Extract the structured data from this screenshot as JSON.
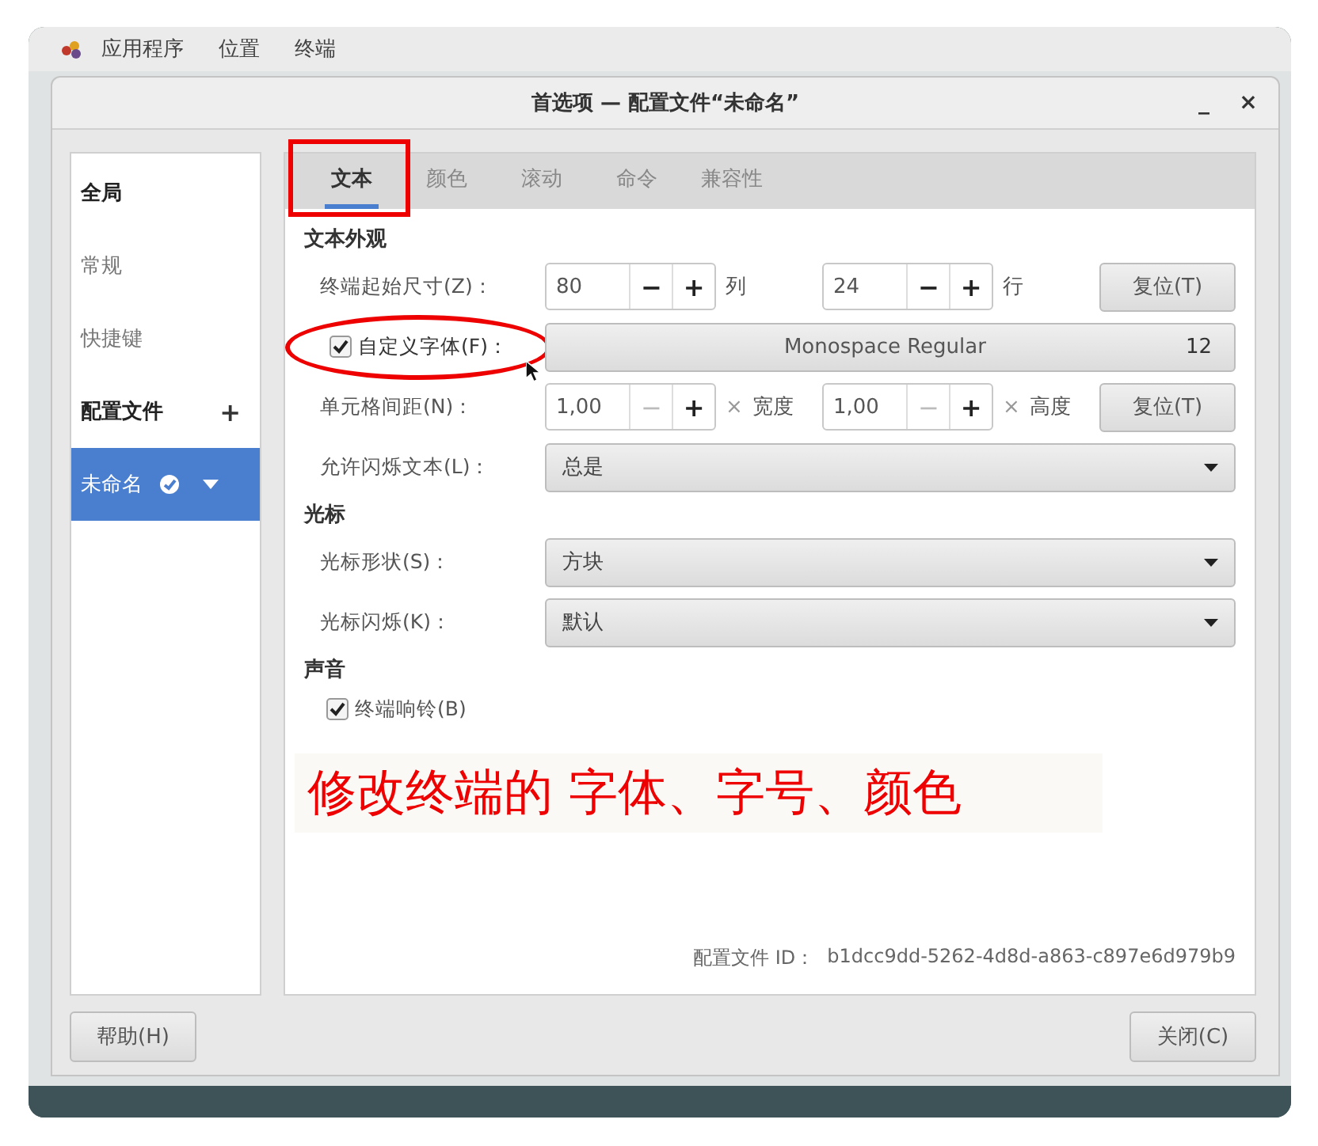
{
  "topbar": {
    "menus": [
      "应用程序",
      "位置",
      "终端"
    ]
  },
  "window": {
    "title": "首选项 — 配置文件“未命名”",
    "minimize": "_",
    "close": "×"
  },
  "sidebar": {
    "items": [
      {
        "kind": "header",
        "label": "全局"
      },
      {
        "kind": "item",
        "label": "常规",
        "selected": false
      },
      {
        "kind": "item",
        "label": "快捷键",
        "selected": false
      },
      {
        "kind": "header",
        "label": "配置文件",
        "add": "+"
      },
      {
        "kind": "profile",
        "label": "未命名",
        "selected": true
      }
    ]
  },
  "tabs": [
    {
      "label": "文本",
      "selected": true,
      "highlighted": true
    },
    {
      "label": "颜色",
      "selected": false,
      "highlighted": false
    },
    {
      "label": "滚动",
      "selected": false,
      "highlighted": false
    },
    {
      "label": "命令",
      "selected": false,
      "highlighted": false
    },
    {
      "label": "兼容性",
      "selected": false,
      "highlighted": false
    }
  ],
  "sections": [
    {
      "title": "文本外观",
      "rows": [
        {
          "kind": "size",
          "label": "终端起始尺寸(Z)：",
          "spins": [
            {
              "value": "80",
              "minus": "−",
              "plus": "+",
              "minus_disabled": false,
              "unit": "列"
            },
            {
              "value": "24",
              "minus": "−",
              "plus": "+",
              "minus_disabled": false,
              "unit": "行"
            }
          ],
          "reset": "复位(T)"
        },
        {
          "kind": "font",
          "label": "自定义字体(F)：",
          "checked": true,
          "circled": true,
          "font": "Monospace Regular",
          "size": "12"
        },
        {
          "kind": "size",
          "label": "单元格间距(N)：",
          "spins": [
            {
              "value": "1,00",
              "minus": "−",
              "plus": "+",
              "minus_disabled": true,
              "sep": "×",
              "unit": "宽度"
            },
            {
              "value": "1,00",
              "minus": "−",
              "plus": "+",
              "minus_disabled": true,
              "sep": "×",
              "unit": "高度"
            }
          ],
          "reset": "复位(T)"
        },
        {
          "kind": "select",
          "label": "允许闪烁文本(L)：",
          "value": "总是"
        }
      ]
    },
    {
      "title": "光标",
      "rows": [
        {
          "kind": "select",
          "label": "光标形状(S)：",
          "value": "方块"
        },
        {
          "kind": "select",
          "label": "光标闪烁(K)：",
          "value": "默认"
        }
      ]
    },
    {
      "title": "声音",
      "rows": [
        {
          "kind": "check",
          "label": "终端响铃(B)",
          "checked": true
        }
      ]
    }
  ],
  "caption": "修改终端的 字体、字号、颜色",
  "profile_id": {
    "label": "配置文件 ID：",
    "value": "b1dcc9dd-5262-4d8d-a863-c897e6d979b9"
  },
  "buttons": [
    {
      "label": "帮助(H)"
    },
    {
      "label": "关闭(C)"
    }
  ]
}
